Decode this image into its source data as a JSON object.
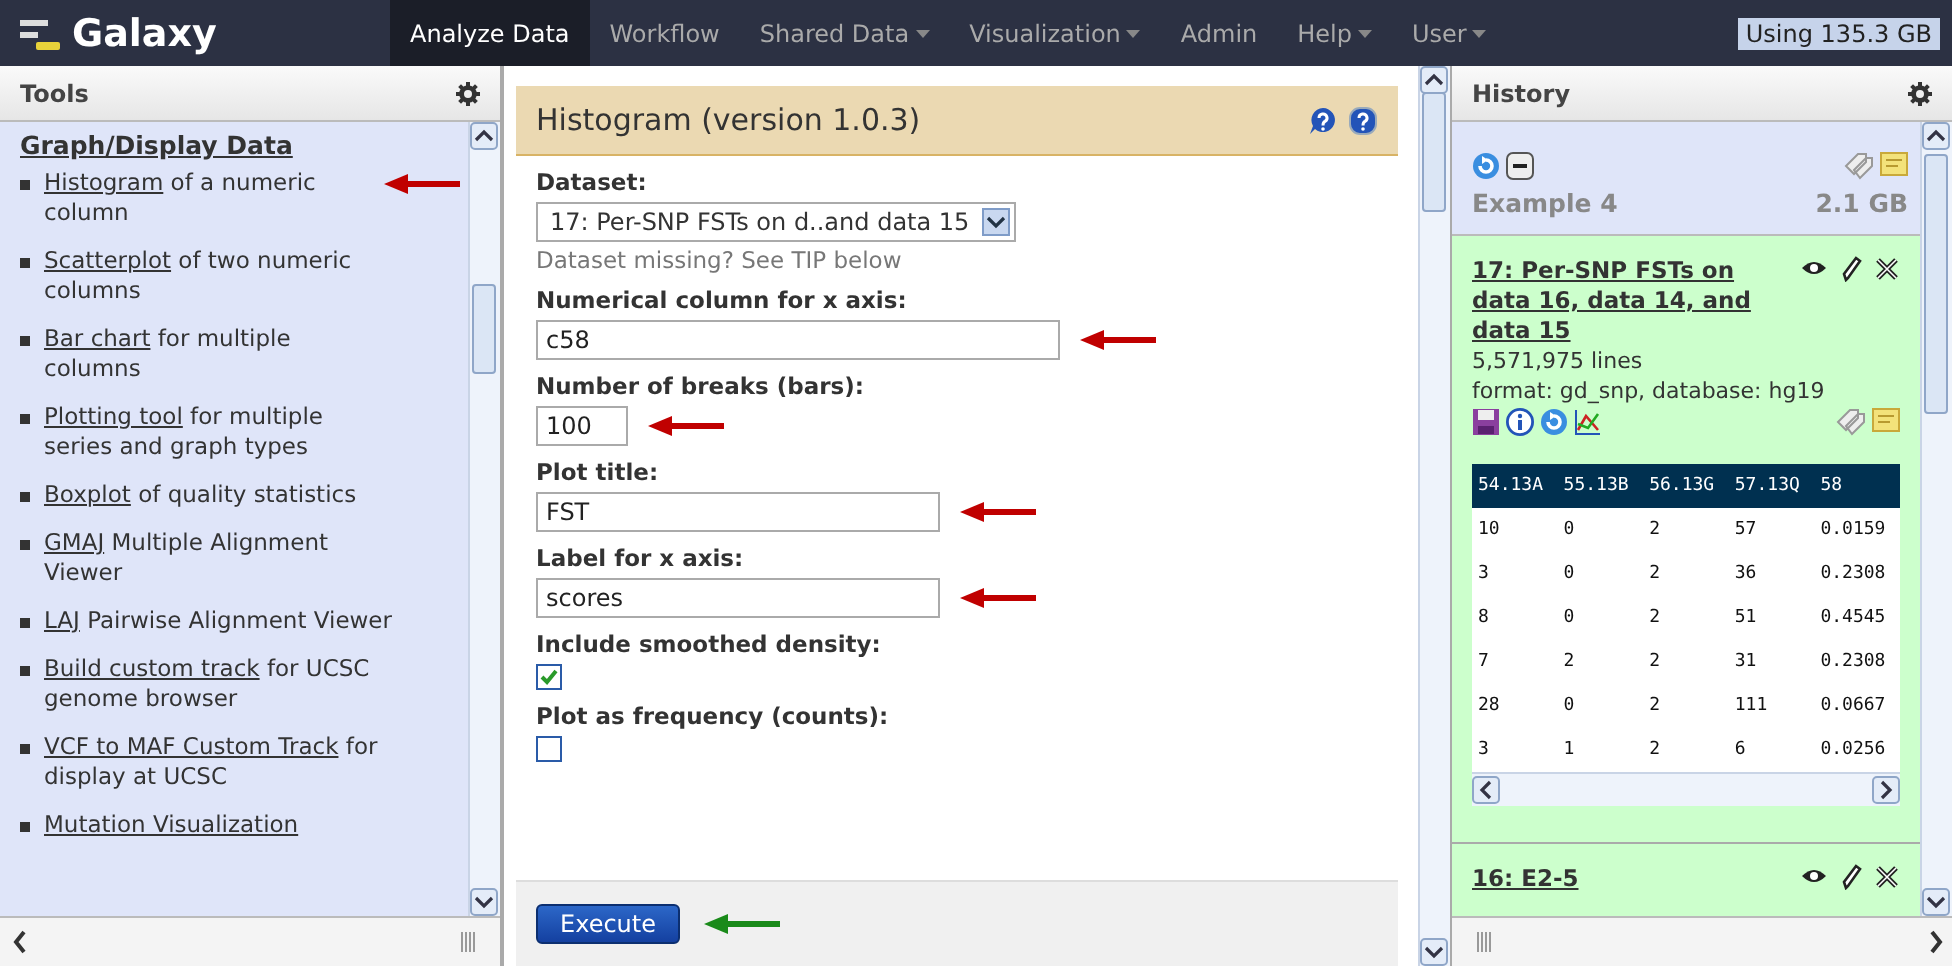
{
  "masthead": {
    "brand": "Galaxy",
    "tabs": [
      {
        "label": "Analyze Data",
        "selected": true,
        "dropdown": false
      },
      {
        "label": "Workflow",
        "selected": false,
        "dropdown": false
      },
      {
        "label": "Shared Data",
        "selected": false,
        "dropdown": true
      },
      {
        "label": "Visualization",
        "selected": false,
        "dropdown": true
      },
      {
        "label": "Admin",
        "selected": false,
        "dropdown": false
      },
      {
        "label": "Help",
        "selected": false,
        "dropdown": true
      },
      {
        "label": "User",
        "selected": false,
        "dropdown": true
      }
    ],
    "usage": "Using 135.3 GB"
  },
  "tools": {
    "title": "Tools",
    "section": "Graph/Display Data",
    "items": [
      {
        "link": "Histogram",
        "text": "of a numeric column",
        "arrow": true
      },
      {
        "link": "Scatterplot",
        "text": "of two numeric columns",
        "arrow": false
      },
      {
        "link": "Bar chart",
        "text": "for multiple columns",
        "arrow": false
      },
      {
        "link": "Plotting tool",
        "text": "for multiple series and graph types",
        "arrow": false
      },
      {
        "link": "Boxplot",
        "text": "of quality statistics",
        "arrow": false
      },
      {
        "link": "GMAJ",
        "text": "Multiple Alignment Viewer",
        "arrow": false
      },
      {
        "link": "LAJ",
        "text": "Pairwise Alignment Viewer",
        "arrow": false
      },
      {
        "link": "Build custom track",
        "text": "for UCSC genome browser",
        "arrow": false
      },
      {
        "link": "VCF to MAF Custom Track",
        "text": "for display at UCSC",
        "arrow": false
      },
      {
        "link": "Mutation Visualization",
        "arrow": false
      }
    ]
  },
  "form": {
    "title": "Histogram (version 1.0.3)",
    "fields": [
      {
        "kind": "select",
        "label": "Dataset:",
        "value": "17: Per-SNP FSTs on d..and data 15",
        "hint": "Dataset missing? See TIP below",
        "arrow": false
      },
      {
        "kind": "text",
        "label": "Numerical column for x axis:",
        "value": "c58",
        "arrow": true
      },
      {
        "kind": "text",
        "label": "Number of breaks (bars):",
        "value": "100",
        "arrow": true
      },
      {
        "kind": "text",
        "label": "Plot title:",
        "value": "FST",
        "arrow": true
      },
      {
        "kind": "text",
        "label": "Label for x axis:",
        "value": "scores",
        "arrow": true
      },
      {
        "kind": "checkbox",
        "label": "Include smoothed density:",
        "checked": true,
        "arrow": false
      },
      {
        "kind": "checkbox",
        "label": "Plot as frequency (counts):",
        "checked": false,
        "arrow": false
      }
    ],
    "execute": {
      "label": "Execute",
      "arrow": true
    }
  },
  "history": {
    "title": "History",
    "name": "Example 4",
    "size": "2.1 GB",
    "datasets": [
      {
        "title": "17: Per-SNP FSTs on data 16, data 14, and data 15",
        "expanded": true,
        "lines": "5,571,975 lines",
        "format": "format: gd_snp, database: hg19",
        "peek": {
          "columns": [
            "54.13A",
            "55.13B",
            "56.13G",
            "57.13Q",
            "58"
          ],
          "rows": [
            [
              "10",
              "0",
              "2",
              "57",
              "0.0159"
            ],
            [
              "3",
              "0",
              "2",
              "36",
              "0.2308"
            ],
            [
              "8",
              "0",
              "2",
              "51",
              "0.4545"
            ],
            [
              "7",
              "2",
              "2",
              "31",
              "0.2308"
            ],
            [
              "28",
              "0",
              "2",
              "111",
              "0.0667"
            ],
            [
              "3",
              "1",
              "2",
              "6",
              "0.0256"
            ]
          ]
        }
      },
      {
        "title": "16: E2-5",
        "expanded": false
      }
    ]
  }
}
